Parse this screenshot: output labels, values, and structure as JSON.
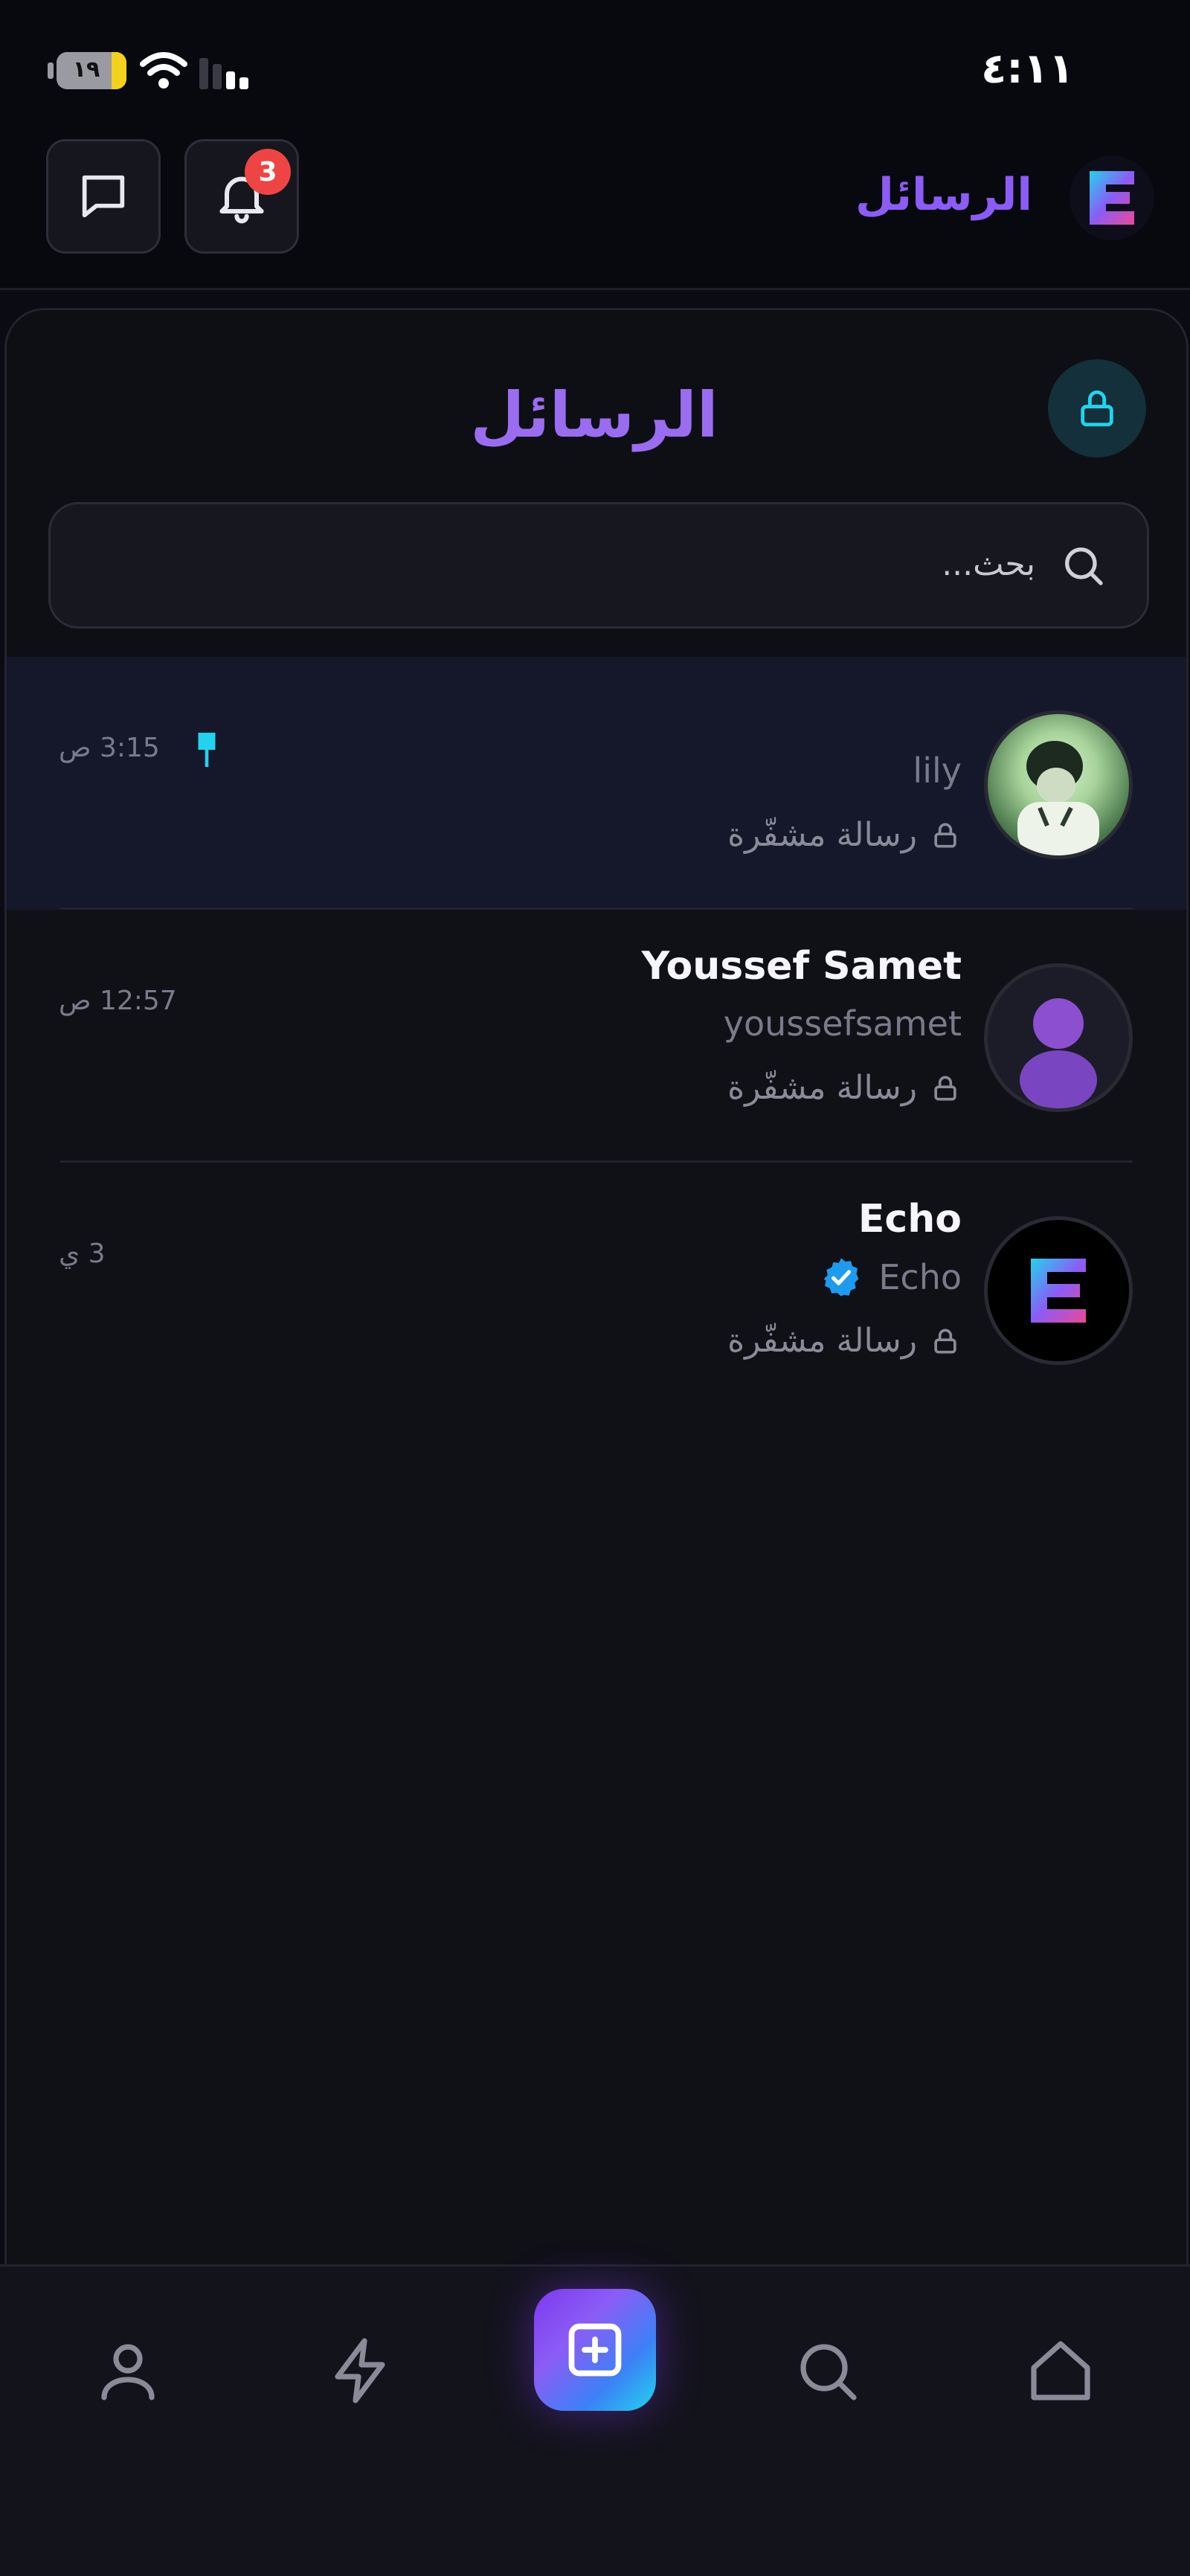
{
  "status_bar": {
    "battery": "١٩",
    "time": "٤:١١"
  },
  "header": {
    "title": "الرسائل",
    "notifications_count": "3"
  },
  "panel": {
    "title": "الرسائل",
    "search_placeholder": "بحث..."
  },
  "conversations": [
    {
      "name": "",
      "username": "lily",
      "preview": "رسالة مشفّرة",
      "time": "3:15 ص",
      "pinned": true,
      "active": true
    },
    {
      "name": "Youssef Samet",
      "username": "youssefsamet",
      "preview": "رسالة مشفّرة",
      "time": "12:57 ص",
      "pinned": false,
      "active": false
    },
    {
      "name": "Echo",
      "username": "Echo",
      "preview": "رسالة مشفّرة",
      "time": "3 ي",
      "verified": true,
      "pinned": false,
      "active": false
    }
  ],
  "nav": [
    "profile-icon",
    "lightning-icon",
    "create-post-icon",
    "search-icon",
    "home-icon"
  ],
  "colors": {
    "accent": "#8b5cf6",
    "cyan": "#22d3ee",
    "badge": "#ef4444",
    "verified": "#1d9bf0"
  }
}
